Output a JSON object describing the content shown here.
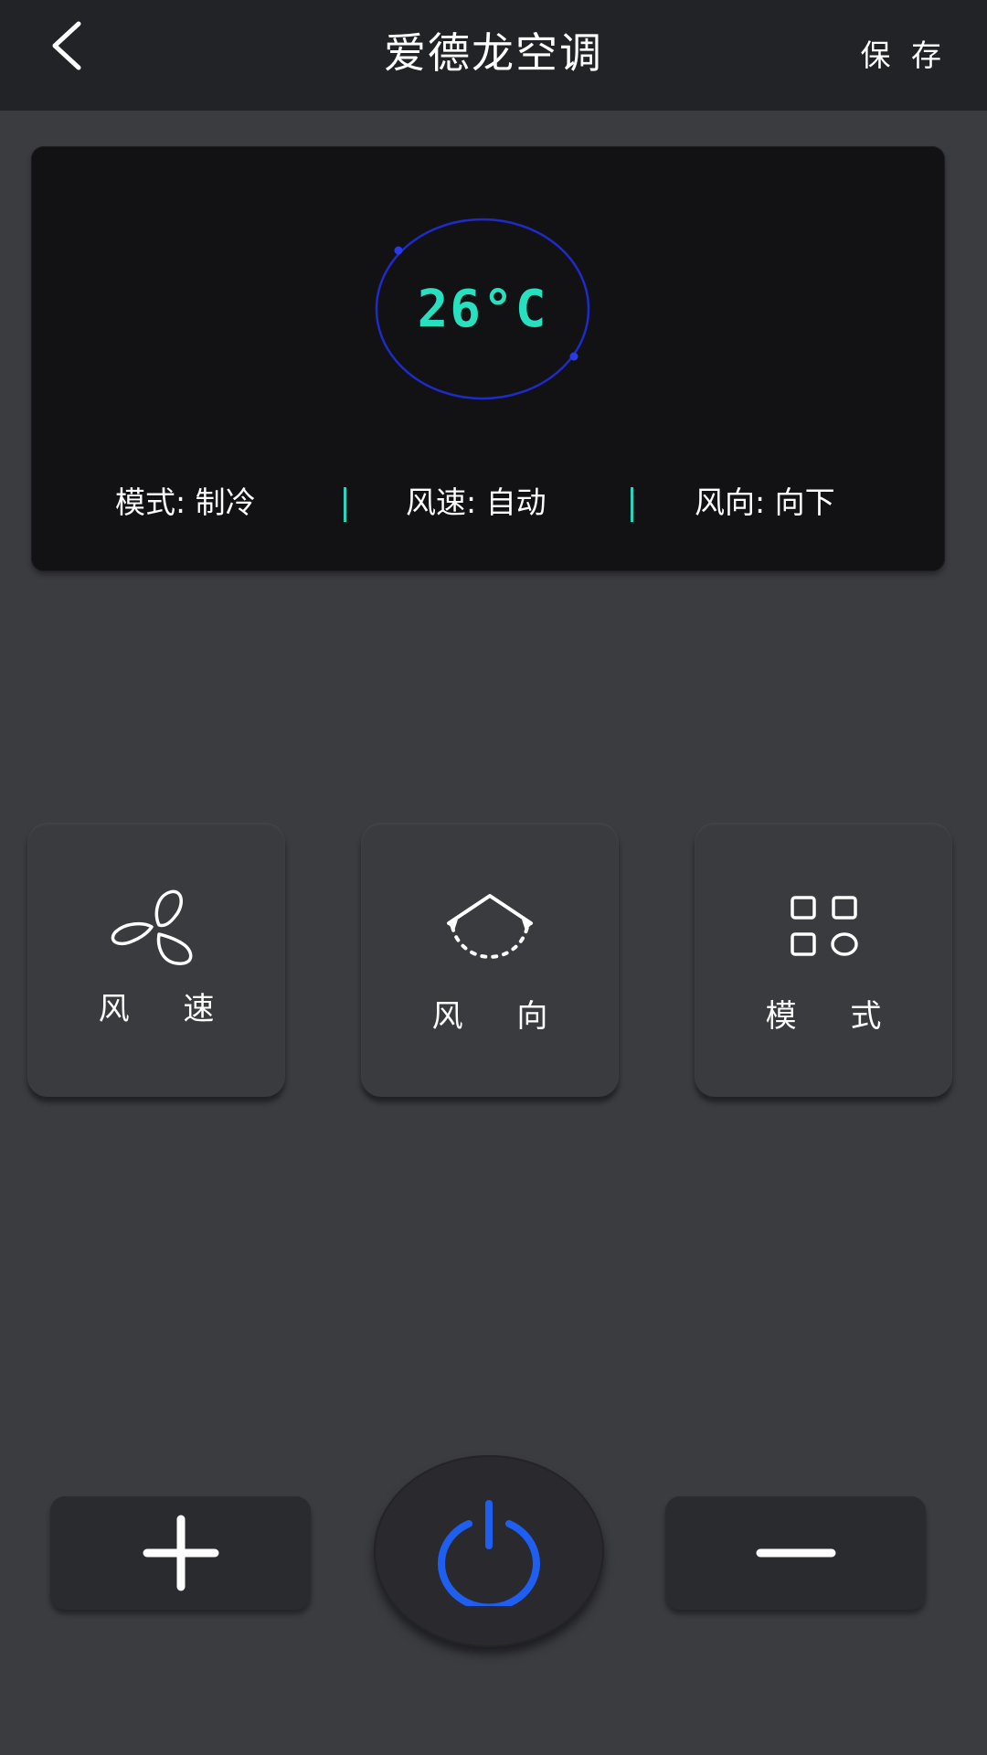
{
  "header": {
    "title": "爱德龙空调",
    "save_label": "保 存",
    "back_icon": "chevron-left-icon"
  },
  "display": {
    "temperature": "26°C",
    "mode": "模式: 制冷",
    "fan_speed": "风速: 自动",
    "fan_direction": "风向: 向下",
    "accent_color": "#26e0c0",
    "ring_color": "#1f2bc9"
  },
  "functions": [
    {
      "label": "风 速",
      "icon": "fan-icon"
    },
    {
      "label": "风 向",
      "icon": "swing-direction-icon"
    },
    {
      "label": "模 式",
      "icon": "mode-grid-icon"
    }
  ],
  "controls": {
    "increase_icon": "plus-icon",
    "power_icon": "power-icon",
    "decrease_icon": "minus-icon",
    "power_color": "#1e5ef0"
  }
}
